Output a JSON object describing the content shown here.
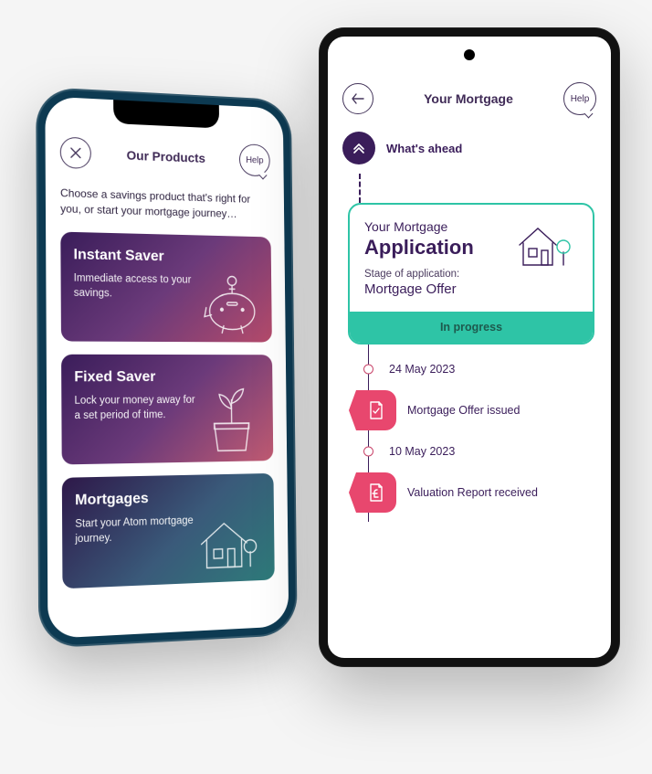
{
  "left": {
    "header": {
      "title": "Our Products",
      "help_label": "Help"
    },
    "intro": "Choose a savings product that's right for you, or start your mortgage journey…",
    "products": [
      {
        "title": "Instant Saver",
        "desc": "Immediate access to your savings."
      },
      {
        "title": "Fixed Saver",
        "desc": "Lock your money away for a set period of time."
      },
      {
        "title": "Mortgages",
        "desc": "Start your Atom mortgage journey."
      }
    ]
  },
  "right": {
    "header": {
      "title": "Your Mortgage",
      "help_label": "Help"
    },
    "ahead_label": "What's ahead",
    "card": {
      "pretitle": "Your Mortgage",
      "title": "Application",
      "stage_label": "Stage of application:",
      "stage_value": "Mortgage Offer",
      "status": "In progress"
    },
    "timeline": [
      {
        "type": "date",
        "text": "24 May 2023"
      },
      {
        "type": "event",
        "text": "Mortgage Offer issued",
        "icon": "doc-check"
      },
      {
        "type": "date",
        "text": "10 May 2023"
      },
      {
        "type": "event",
        "text": "Valuation Report received",
        "icon": "doc-pound"
      }
    ]
  },
  "colors": {
    "brand_purple": "#3a1d5a",
    "accent_teal": "#2ec4a6",
    "accent_pink": "#e8476e"
  }
}
